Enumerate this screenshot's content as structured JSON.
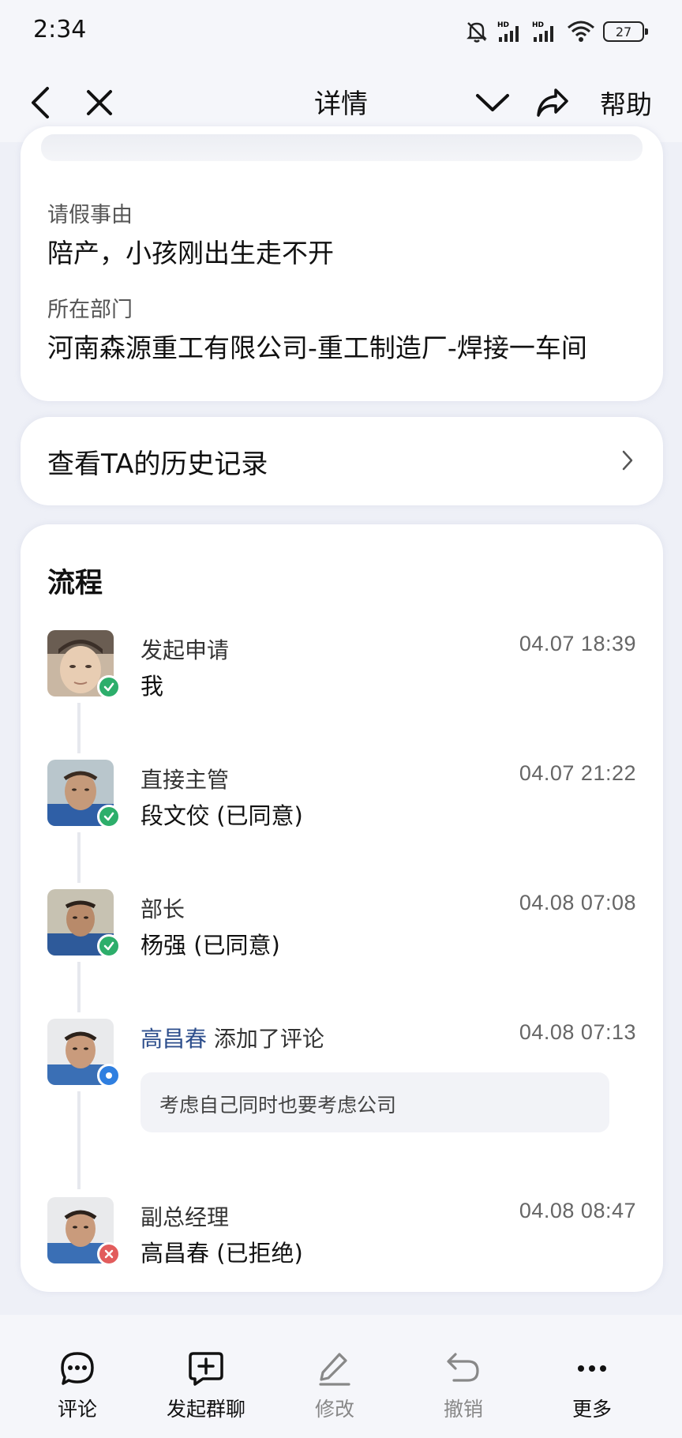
{
  "status_bar": {
    "time": "2:34",
    "battery": "27"
  },
  "nav": {
    "title": "详情",
    "help_label": "帮助"
  },
  "details": {
    "reason_label": "请假事由",
    "reason_value": "陪产，小孩刚出生走不开",
    "dept_label": "所在部门",
    "dept_value": "河南森源重工有限公司-重工制造厂-焊接一车间"
  },
  "history": {
    "label": "查看TA的历史记录"
  },
  "flow": {
    "title": "流程",
    "steps": [
      {
        "role": "发起申请",
        "name": "我",
        "time": "04.07 18:39",
        "status": "approved"
      },
      {
        "role": "直接主管",
        "name": "段文佼 (已同意)",
        "time": "04.07 21:22",
        "status": "approved"
      },
      {
        "role": "部长",
        "name": "杨强 (已同意)",
        "time": "04.08 07:08",
        "status": "approved"
      },
      {
        "commenter": "高昌春",
        "action": " 添加了评论",
        "time": "04.08 07:13",
        "comment": "考虑自己同时也要考虑公司",
        "status": "comment"
      },
      {
        "role": "副总经理",
        "name": "高昌春 (已拒绝)",
        "time": "04.08 08:47",
        "status": "rejected"
      }
    ]
  },
  "actions": [
    {
      "label": "评论",
      "icon": "comment-icon",
      "enabled": true
    },
    {
      "label": "发起群聊",
      "icon": "group-chat-icon",
      "enabled": true
    },
    {
      "label": "修改",
      "icon": "edit-icon",
      "enabled": false
    },
    {
      "label": "撤销",
      "icon": "undo-icon",
      "enabled": false
    },
    {
      "label": "更多",
      "icon": "more-icon",
      "enabled": true
    }
  ],
  "colors": {
    "approved": "#2dae6b",
    "rejected": "#e25c5c",
    "comment": "#2f7fe0",
    "commenter": "#2d4e8c"
  }
}
